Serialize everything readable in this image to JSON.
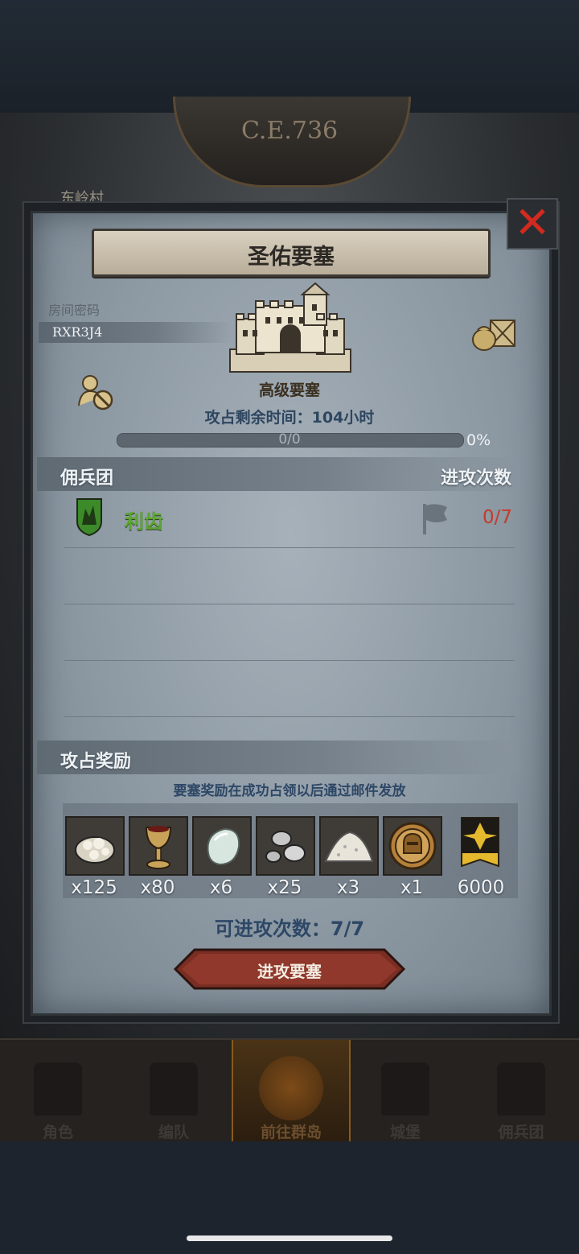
{
  "background": {
    "date_label": "C.E.736",
    "village_label": "东岭村"
  },
  "dialog": {
    "title": "圣佑要塞",
    "room_code_label": "房间密码",
    "room_code": "RXR3J4",
    "fort_level": "高级要塞",
    "time_left": "攻占剩余时间：104小时",
    "progress": {
      "count_text": "0/0",
      "percent_text": "0%",
      "fraction": 0
    },
    "mercenary_header": "佣兵团",
    "attack_count_header": "进攻次数",
    "guilds": [
      {
        "name": "利齿",
        "attacks": "0/7"
      }
    ],
    "rewards_header": "攻占奖励",
    "rewards_note": "要塞奖励在成功占领以后通过邮件发放",
    "rewards": [
      {
        "icon": "silver-ore-icon",
        "qty": "x125"
      },
      {
        "icon": "goblet-icon",
        "qty": "x80"
      },
      {
        "icon": "moonstone-icon",
        "qty": "x6"
      },
      {
        "icon": "silver-pearls-icon",
        "qty": "x25"
      },
      {
        "icon": "salt-pile-icon",
        "qty": "x3"
      },
      {
        "icon": "knight-helmet-medal-icon",
        "qty": "x1"
      },
      {
        "icon": "guild-banner-icon",
        "qty": "6000"
      }
    ],
    "attacks_available": "可进攻次数：7/7",
    "attack_button": "进攻要塞"
  },
  "bottom_nav": [
    {
      "label": "角色",
      "active": false
    },
    {
      "label": "编队",
      "active": false
    },
    {
      "label": "前往群岛",
      "active": true
    },
    {
      "label": "城堡",
      "active": false
    },
    {
      "label": "佣兵团",
      "active": false
    }
  ],
  "colors": {
    "guild_name": "#5ca634",
    "attack_count": "#c43a2c",
    "close_x": "#d22a1f",
    "info_blue": "#2d4766"
  }
}
